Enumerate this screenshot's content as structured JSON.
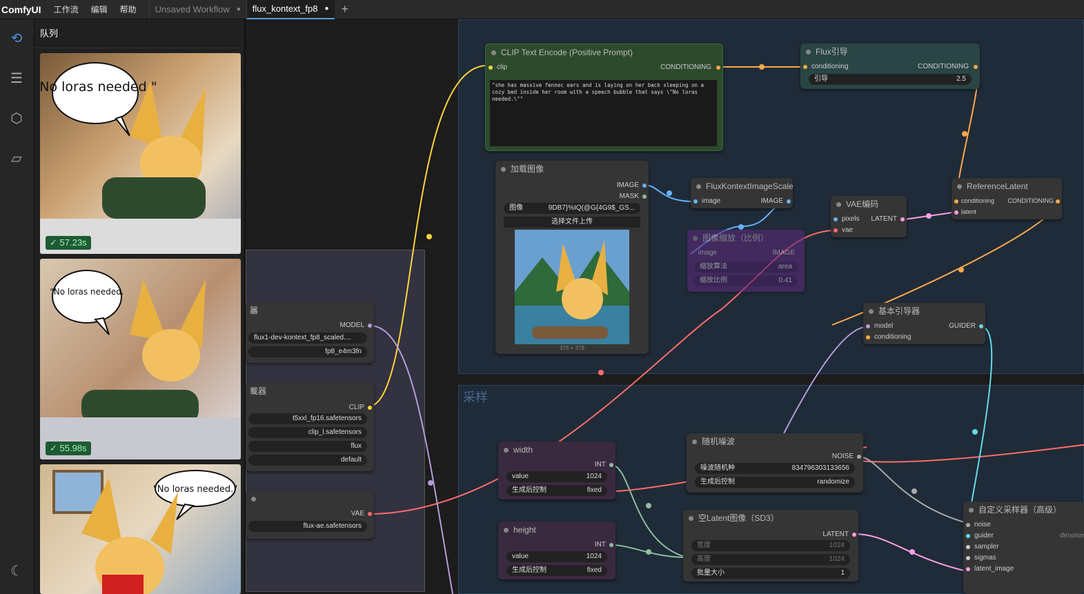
{
  "app": {
    "logo": "ComfyUI",
    "menus": [
      "工作流",
      "编辑",
      "帮助"
    ]
  },
  "tabs": [
    {
      "label": "Unsaved Workflow",
      "active": false
    },
    {
      "label": "flux_kontext_fp8",
      "active": true
    }
  ],
  "sidebar": {
    "title": "队列",
    "items": [
      {
        "time": "57.23s"
      },
      {
        "time": "55.98s"
      },
      {
        "time": ""
      }
    ]
  },
  "bubbles": [
    "\"No loras needed.\"",
    "\"No loras needed.",
    "\"No loras needed.\""
  ],
  "groups": {
    "sampling": "采样"
  },
  "nodes": {
    "clip_text": {
      "title": "CLIP Text Encode (Positive Prompt)",
      "in": "clip",
      "out": "CONDITIONING",
      "prompt": "\"she has massive fennec ears and is laying on her back sleeping on a cozy bed inside her room with a speech bubble that says \\\"No loras needed.\\\"\""
    },
    "flux_guide": {
      "title": "Flux引导",
      "in": "conditioning",
      "out": "CONDITIONING",
      "w_label": "引导",
      "w_value": "2.5"
    },
    "load_image": {
      "title": "加载图像",
      "out1": "IMAGE",
      "out2": "MASK",
      "w_label": "图像",
      "w_value": "9DB7}%IQ(@G{4G9$_GS...",
      "upload": "选择文件上传",
      "size": "376 × 378"
    },
    "kontext_scale": {
      "title": "FluxKontextImageScale",
      "in": "image",
      "out": "IMAGE"
    },
    "vae_encode": {
      "title": "VAE编码",
      "in1": "pixels",
      "in2": "vae",
      "out": "LATENT"
    },
    "ref_latent": {
      "title": "ReferenceLatent",
      "in1": "conditioning",
      "in2": "latent",
      "out": "CONDITIONING"
    },
    "basic_guider": {
      "title": "基本引导器",
      "in1": "model",
      "in2": "conditioning",
      "out": "GUIDER"
    },
    "unet": {
      "title": "器",
      "out": "MODEL",
      "w1": "flux1-dev-kontext_fp8_scaled....",
      "w2": "fp8_e4m3fn"
    },
    "dualclip": {
      "title": "载器",
      "out": "CLIP",
      "w1": "t5xxl_fp16.safetensors",
      "w2": "clip_l.safetensors",
      "w3": "flux",
      "w4": "default"
    },
    "vae_loader": {
      "title": "",
      "out": "VAE",
      "w1": "flux-ae.safetensors"
    },
    "width": {
      "title": "width",
      "out": "INT",
      "v_label": "value",
      "v_value": "1024",
      "c_label": "生成后控制",
      "c_value": "fixed"
    },
    "height": {
      "title": "height",
      "out": "INT",
      "v_label": "value",
      "v_value": "1024",
      "c_label": "生成后控制",
      "c_value": "fixed"
    },
    "noise": {
      "title": "随机噪波",
      "out": "NOISE",
      "seed_label": "噪波随机种",
      "seed": "834796303133656",
      "c_label": "生成后控制",
      "c_value": "randomize"
    },
    "empty_latent": {
      "title": "空Latent图像（SD3）",
      "out": "LATENT",
      "w_label": "宽度",
      "w_value": "1024",
      "h_label": "高度",
      "h_value": "1024",
      "b_label": "批量大小",
      "b_value": "1"
    },
    "sampler_adv": {
      "title": "自定义采样器（高级）",
      "in": [
        "noise",
        "guider",
        "sampler",
        "sigmas",
        "latent_image"
      ],
      "out": "denoise"
    },
    "bypassed": {
      "title": "图像缩放（比例）",
      "in": "image",
      "out": "IMAGE",
      "w1_label": "缩放算法",
      "w1_value": "area",
      "w2_label": "缩放比例",
      "w2_value": "0.41"
    }
  },
  "colors": {
    "accent": "#5b9bd5",
    "badge": "#1e5a33",
    "clip_yellow": "#ffd43b",
    "vae_red": "#ff6b6b",
    "model_lav": "#b39ddb",
    "cond_orange": "#ffa94d",
    "latent_pink": "#ff9ee5",
    "guider_cyan": "#66d9e8"
  }
}
